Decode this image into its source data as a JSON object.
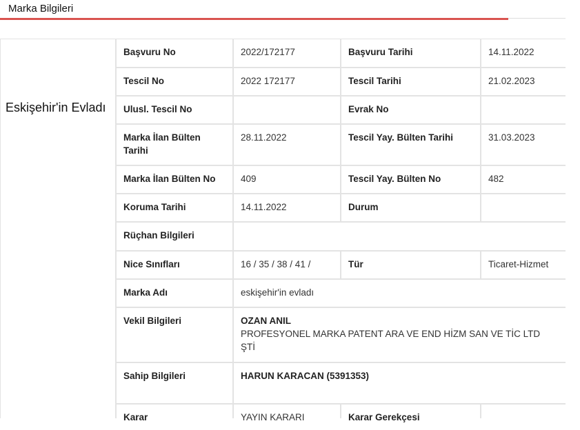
{
  "header": {
    "title": "Marka Bilgileri",
    "accent_color": "#d9534f"
  },
  "side": {
    "title": "Eskişehir'in Evladı"
  },
  "rows": {
    "basvuru_no_label": "Başvuru No",
    "basvuru_no": "2022/172177",
    "basvuru_tarihi_label": "Başvuru Tarihi",
    "basvuru_tarihi": "14.11.2022",
    "tescil_no_label": "Tescil No",
    "tescil_no": "2022 172177",
    "tescil_tarihi_label": "Tescil Tarihi",
    "tescil_tarihi": "21.02.2023",
    "ulusl_tescil_no_label": "Ulusl. Tescil No",
    "ulusl_tescil_no": "",
    "evrak_no_label": "Evrak No",
    "evrak_no": "",
    "ilan_bulten_tarihi_label": "Marka İlan Bülten Tarihi",
    "ilan_bulten_tarihi": "28.11.2022",
    "tescil_yay_bulten_tarihi_label": "Tescil Yay. Bülten Tarihi",
    "tescil_yay_bulten_tarihi": "31.03.2023",
    "ilan_bulten_no_label": "Marka İlan Bülten No",
    "ilan_bulten_no": "409",
    "tescil_yay_bulten_no_label": "Tescil Yay. Bülten No",
    "tescil_yay_bulten_no": "482",
    "koruma_tarihi_label": "Koruma Tarihi",
    "koruma_tarihi": "14.11.2022",
    "durum_label": "Durum",
    "durum": "",
    "ruchan_label": "Rüçhan Bilgileri",
    "ruchan": "",
    "nice_label": "Nice Sınıfları",
    "nice": "16 / 35 / 38 / 41 /",
    "tur_label": "Tür",
    "tur": "Ticaret-Hizmet",
    "marka_adi_label": "Marka Adı",
    "marka_adi": "eskişehir'in evladı",
    "vekil_label": "Vekil Bilgileri",
    "vekil_name": "OZAN ANIL",
    "vekil_firm": "PROFESYONEL MARKA PATENT ARA VE END HİZM SAN VE TİC LTD ŞTİ",
    "sahip_label": "Sahip Bilgileri",
    "sahip": "HARUN KARACAN (5391353)",
    "karar_label": "Karar",
    "karar": "YAYIN KARARI",
    "karar_gerekcesi_label": "Karar Gerekçesi",
    "karar_gerekcesi": ""
  }
}
